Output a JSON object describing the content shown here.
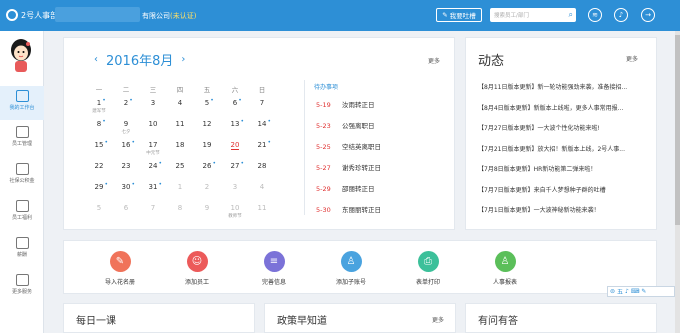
{
  "topbar": {
    "logo": "2号人事部",
    "company_suffix": "有限公司",
    "cert_tag": "(未认证)",
    "feedback": "我要吐槽",
    "search_placeholder": "搜索员工/部门"
  },
  "sidebar": {
    "items": [
      {
        "label": "我的工作台",
        "icon": "monitor-icon",
        "active": true
      },
      {
        "label": "员工管理",
        "icon": "employee-icon"
      },
      {
        "label": "社保公积金",
        "icon": "house-icon"
      },
      {
        "label": "员工福利",
        "icon": "gift-icon"
      },
      {
        "label": "薪酬",
        "icon": "wallet-icon"
      },
      {
        "label": "更多服务",
        "icon": "grid-icon"
      }
    ]
  },
  "calendar": {
    "title": "2016年8月",
    "more": "更多",
    "weekdays": [
      "一",
      "二",
      "三",
      "四",
      "五",
      "六",
      "日"
    ],
    "weeks": [
      [
        {
          "d": "1",
          "sub": "建军节",
          "dot": true
        },
        {
          "d": "2",
          "dot": true
        },
        {
          "d": "3"
        },
        {
          "d": "4"
        },
        {
          "d": "5",
          "dot": true
        },
        {
          "d": "6",
          "dot": true
        },
        {
          "d": "7"
        }
      ],
      [
        {
          "d": "8",
          "dot": true
        },
        {
          "d": "9",
          "sub": "七夕"
        },
        {
          "d": "10"
        },
        {
          "d": "11"
        },
        {
          "d": "12"
        },
        {
          "d": "13",
          "dot": true
        },
        {
          "d": "14",
          "dot": true
        }
      ],
      [
        {
          "d": "15",
          "dot": true
        },
        {
          "d": "16",
          "dot": true
        },
        {
          "d": "17",
          "sub": "中元节"
        },
        {
          "d": "18"
        },
        {
          "d": "19"
        },
        {
          "d": "20",
          "today": true
        },
        {
          "d": "21",
          "dot": true
        }
      ],
      [
        {
          "d": "22"
        },
        {
          "d": "23"
        },
        {
          "d": "24",
          "dot": true
        },
        {
          "d": "25"
        },
        {
          "d": "26",
          "dot": true
        },
        {
          "d": "27",
          "dot": true
        },
        {
          "d": "28"
        }
      ],
      [
        {
          "d": "29",
          "dot": true
        },
        {
          "d": "30",
          "dot": true
        },
        {
          "d": "31",
          "dot": true
        },
        {
          "d": "1",
          "dim": true
        },
        {
          "d": "2",
          "dim": true
        },
        {
          "d": "3",
          "dim": true
        },
        {
          "d": "4",
          "dim": true
        }
      ],
      [
        {
          "d": "5",
          "dim": true
        },
        {
          "d": "6",
          "dim": true
        },
        {
          "d": "7",
          "dim": true
        },
        {
          "d": "8",
          "dim": true
        },
        {
          "d": "9",
          "dim": true
        },
        {
          "d": "10",
          "dim": true,
          "sub": "教师节"
        },
        {
          "d": "11",
          "dim": true
        }
      ]
    ],
    "todo_title": "待办事项",
    "todos": [
      {
        "date": "5-19",
        "text": "汝雨转正日"
      },
      {
        "date": "5-23",
        "text": "公强离职日"
      },
      {
        "date": "5-25",
        "text": "空结英离职日"
      },
      {
        "date": "5-27",
        "text": "谢秀珍转正日"
      },
      {
        "date": "5-29",
        "text": "邵丽转正日"
      },
      {
        "date": "5-30",
        "text": "东丽丽转正日"
      }
    ]
  },
  "news": {
    "title": "动态",
    "more": "更多",
    "items": [
      "【8月11日版本更新】新一轮功能强劲来袭，准备接招...",
      "【8月4日版本更新】新版本上线啦，更多人事常用报...",
      "【7月27日版本更新】一大波个性化功能来啦!",
      "【7月21日版本更新】放大招！新版本上线，2号人事...",
      "【7月8日版本更新】HR新功能第二弹来啦！",
      "【7月7日版本更新】来自千人梦想种子群的吐槽",
      "【7月1日版本更新】一大波神秘新功能来袭！"
    ]
  },
  "quick_actions": [
    {
      "label": "导入花名册",
      "color": "#f0735a",
      "glyph": "✎"
    },
    {
      "label": "添加员工",
      "color": "#ec5a5a",
      "glyph": "☺"
    },
    {
      "label": "完善信息",
      "color": "#7b72d8",
      "glyph": "≡"
    },
    {
      "label": "添加子账号",
      "color": "#4aa3df",
      "glyph": "♙"
    },
    {
      "label": "表单打印",
      "color": "#3cc09a",
      "glyph": "⎙"
    },
    {
      "label": "人事报表",
      "color": "#5bbf5a",
      "glyph": "♙"
    }
  ],
  "bottom": {
    "daily": "每日一课",
    "policy": "政策早知道",
    "policy_more": "更多",
    "qa": "有问有答"
  },
  "ime": {
    "label": "五"
  }
}
